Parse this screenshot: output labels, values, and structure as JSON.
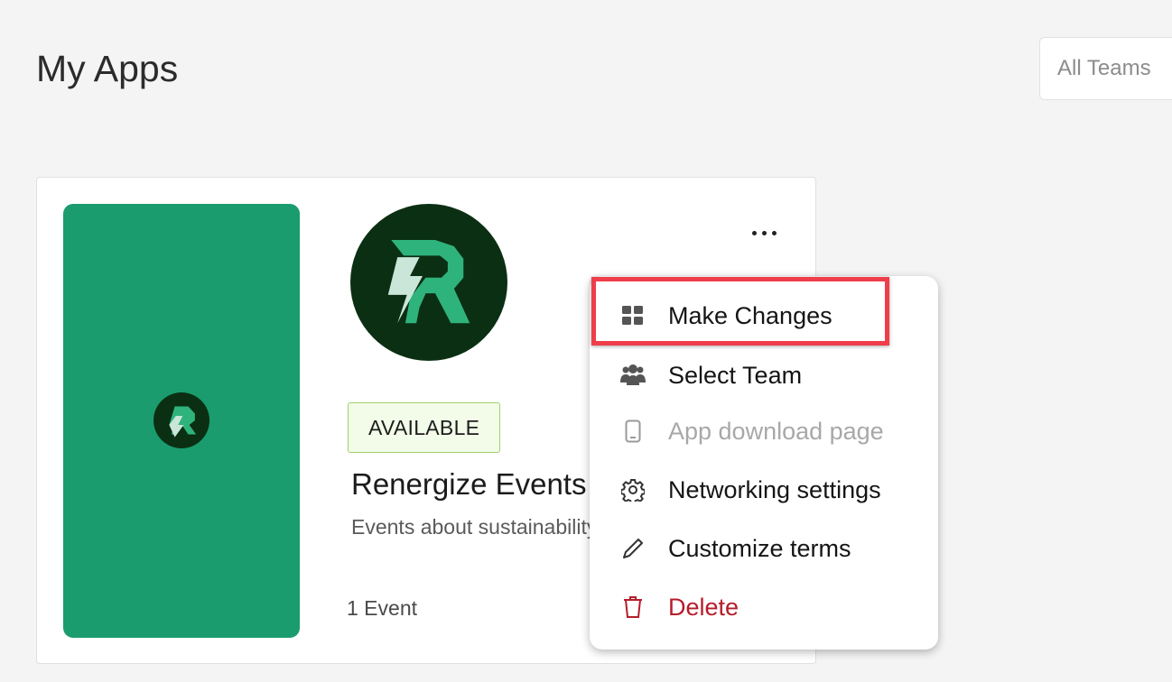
{
  "header": {
    "title": "My Apps",
    "team_filter": "All Teams"
  },
  "app": {
    "status": "AVAILABLE",
    "name": "Renergize Events",
    "description": "Events about sustainability",
    "event_count": "1 Event",
    "brand_color": "#1a9c6e",
    "logo_bg": "#0b2f13"
  },
  "menu": {
    "items": [
      {
        "label": "Make Changes",
        "icon": "grid-icon",
        "state": "highlighted"
      },
      {
        "label": "Select Team",
        "icon": "team-icon",
        "state": "normal"
      },
      {
        "label": "App download page",
        "icon": "phone-icon",
        "state": "disabled"
      },
      {
        "label": "Networking settings",
        "icon": "gear-icon",
        "state": "normal"
      },
      {
        "label": "Customize terms",
        "icon": "pen-icon",
        "state": "normal"
      },
      {
        "label": "Delete",
        "icon": "trash-icon",
        "state": "danger"
      }
    ],
    "highlight_color": "#ef3e4a",
    "danger_color": "#b51d2a"
  }
}
